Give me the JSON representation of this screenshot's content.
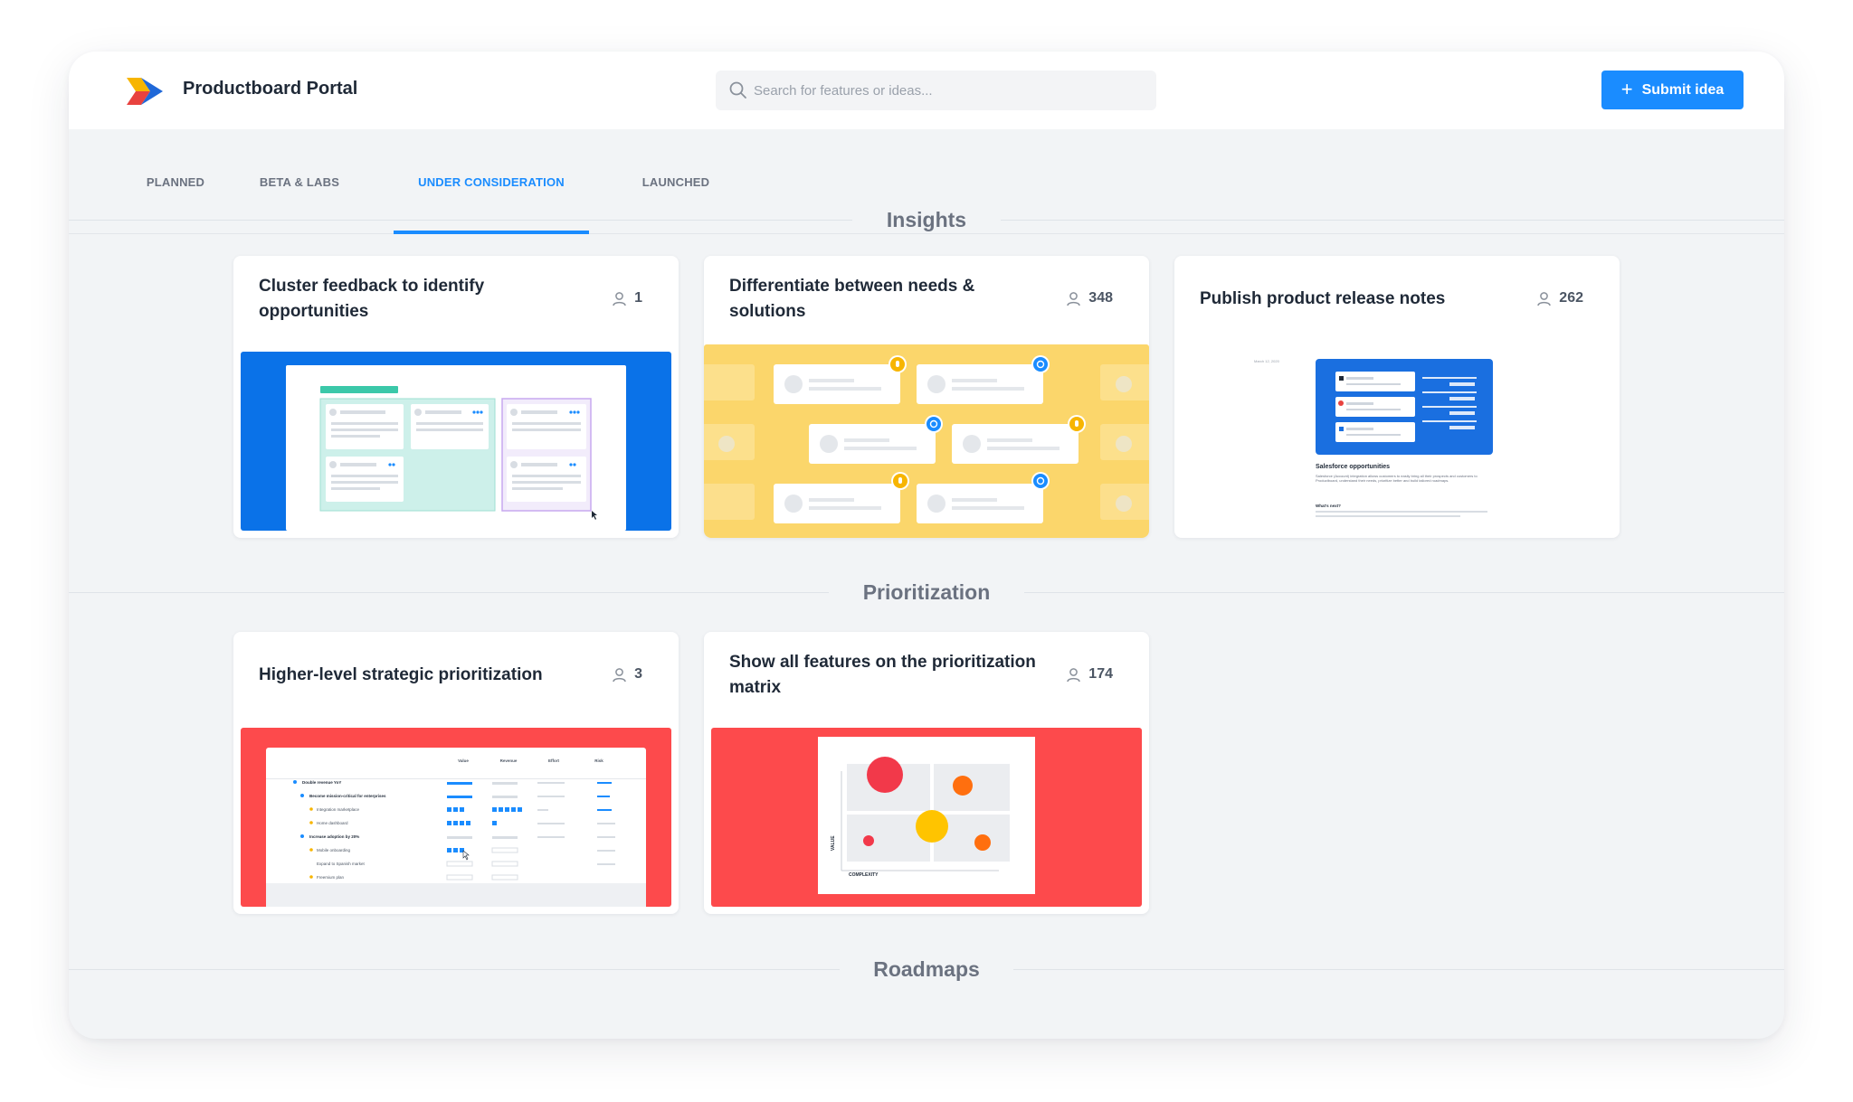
{
  "app": {
    "title": "Productboard Portal"
  },
  "search": {
    "placeholder": "Search for features or ideas..."
  },
  "actions": {
    "submit_label": "Submit idea"
  },
  "tabs": [
    {
      "label": "PLANNED",
      "active": false
    },
    {
      "label": "BETA & LABS",
      "active": false
    },
    {
      "label": "UNDER CONSIDERATION",
      "active": true
    },
    {
      "label": "LAUNCHED",
      "active": false
    }
  ],
  "sections": [
    {
      "title": "Insights",
      "cards": [
        {
          "title": "Cluster feedback to identify opportunities",
          "voters": "1"
        },
        {
          "title": "Differentiate between needs & solutions",
          "voters": "348"
        },
        {
          "title": "Publish product release notes",
          "voters": "262",
          "preview": {
            "heading": "Salesforce opportunities",
            "subheading": "What's next?",
            "body": "Salesforce (Account) integration allows customers to easily bring all their prospects and customers to Productboard, understand their needs, prioritize better and build tailored roadmaps.",
            "date": "March 12, 2020"
          }
        }
      ]
    },
    {
      "title": "Prioritization",
      "cards": [
        {
          "title": "Higher-level strategic prioritization",
          "voters": "3",
          "preview": {
            "columns": [
              "Value",
              "Revenue",
              "Effort",
              "Risk"
            ],
            "rows": [
              "Double revenue YoY",
              "Become mission-critical for enterprises",
              "Integration marketplace",
              "Home dashboard",
              "Increase adoption by 20%",
              "Mobile onboarding",
              "Expand to Spanish market",
              "Freemium plan"
            ]
          }
        },
        {
          "title": "Show all features on the prioritization matrix",
          "voters": "174",
          "preview": {
            "y_label": "VALUE",
            "x_label": "COMPLEXITY"
          }
        }
      ]
    },
    {
      "title": "Roadmaps",
      "cards": []
    }
  ],
  "colors": {
    "accent": "#1a8cff",
    "blue_thumb": "#0a72e8",
    "yellow_thumb": "#fbd66b",
    "red_thumb": "#fd4a4c"
  }
}
